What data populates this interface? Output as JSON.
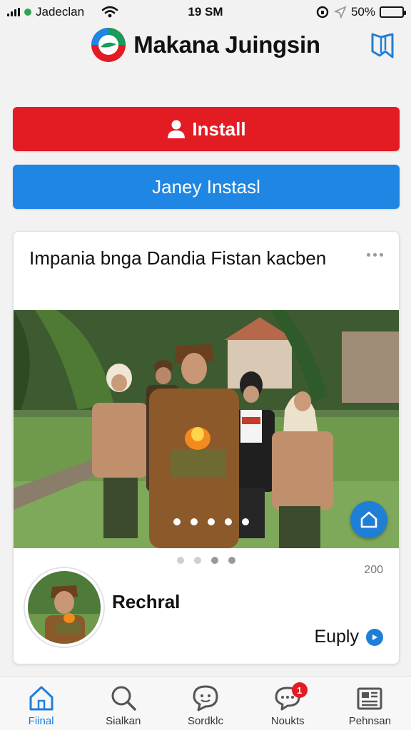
{
  "status_bar": {
    "carrier": "Jadeclan",
    "time": "19 SM",
    "battery": "50%",
    "battery_level": 0.5
  },
  "header": {
    "title": "Makana Juingsin",
    "bookmark_icon": "bookmark-icon"
  },
  "buttons": {
    "install_label": "Install",
    "secondary_label": "Janey Instasl"
  },
  "card": {
    "title": "Impania bnga Dandia Fistan kacben",
    "slide_count": 5,
    "active_page": 3,
    "count": "200",
    "author": "Rechral",
    "reply_label": "Euply"
  },
  "nav": [
    {
      "label": "Fiinal",
      "icon": "home-icon",
      "active": true
    },
    {
      "label": "Sialkan",
      "icon": "search-icon",
      "active": false
    },
    {
      "label": "Sordklc",
      "icon": "chat-icon",
      "active": false
    },
    {
      "label": "Noukts",
      "icon": "notification-icon",
      "active": false,
      "badge": "1"
    },
    {
      "label": "Pehnsan",
      "icon": "news-icon",
      "active": false
    }
  ],
  "colors": {
    "install": "#e31c24",
    "secondary": "#1f86e3",
    "accent": "#1f7fd6"
  }
}
